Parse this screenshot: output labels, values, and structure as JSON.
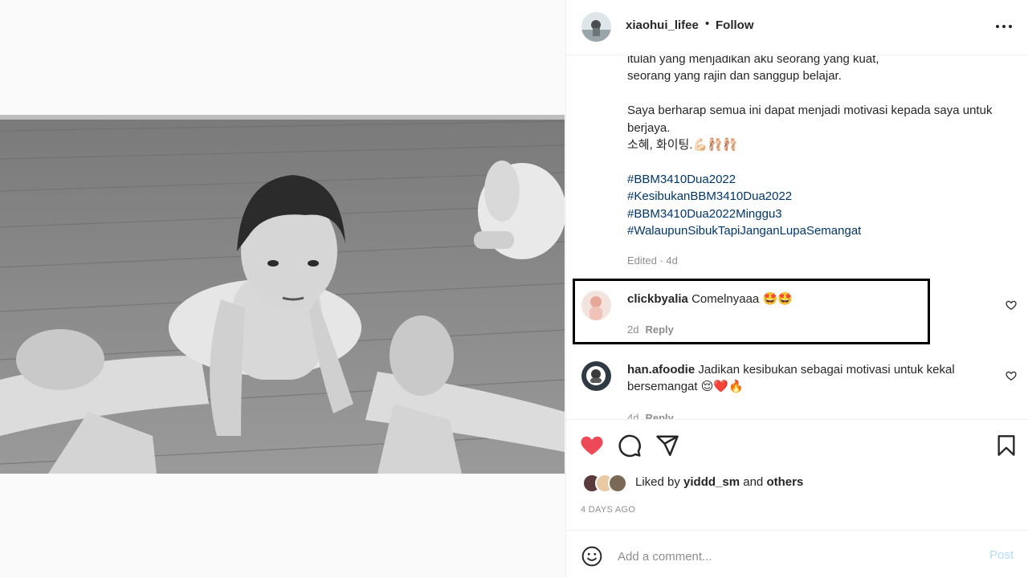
{
  "header": {
    "username": "xiaohui_lifee",
    "separator": "•",
    "follow_label": "Follow",
    "more_icon": "more-horizontal-icon"
  },
  "caption": {
    "lines": [
      "itulah yang menjadikan aku seorang yang kuat,",
      "seorang yang rajin dan sanggup belajar.",
      "",
      "Saya berharap semua ini dapat menjadi motivasi kepada saya untuk",
      "berjaya.",
      "소혜, 화이팅.💪🏻🩰🩰"
    ],
    "hashtags": [
      "#BBM3410Dua2022",
      "#KesibukanBBM3410Dua2022",
      "#BBM3410Dua2022Minggu3",
      "#WalaupunSibukTapiJanganLupaSemangat"
    ],
    "edited": "Edited · 4d"
  },
  "comments": [
    {
      "username": "clickbyalia",
      "text": "Comelnyaaa 🤩🤩",
      "age": "2d",
      "reply_label": "Reply"
    },
    {
      "username": "han.afoodie",
      "text": "Jadikan kesibukan sebagai motivasi untuk kekal bersemangat 😌❤️🔥",
      "age": "4d",
      "reply_label": "Reply"
    }
  ],
  "actions": {
    "like_icon": "heart-filled-icon",
    "comment_icon": "comment-icon",
    "share_icon": "share-icon",
    "save_icon": "bookmark-icon",
    "like_color": "#ed4956"
  },
  "likes": {
    "prefix": "Liked by",
    "user": "yiddd_sm",
    "joiner": "and",
    "others": "others"
  },
  "time_ago": "4 DAYS AGO",
  "add_comment": {
    "placeholder": "Add a comment...",
    "post_label": "Post"
  }
}
